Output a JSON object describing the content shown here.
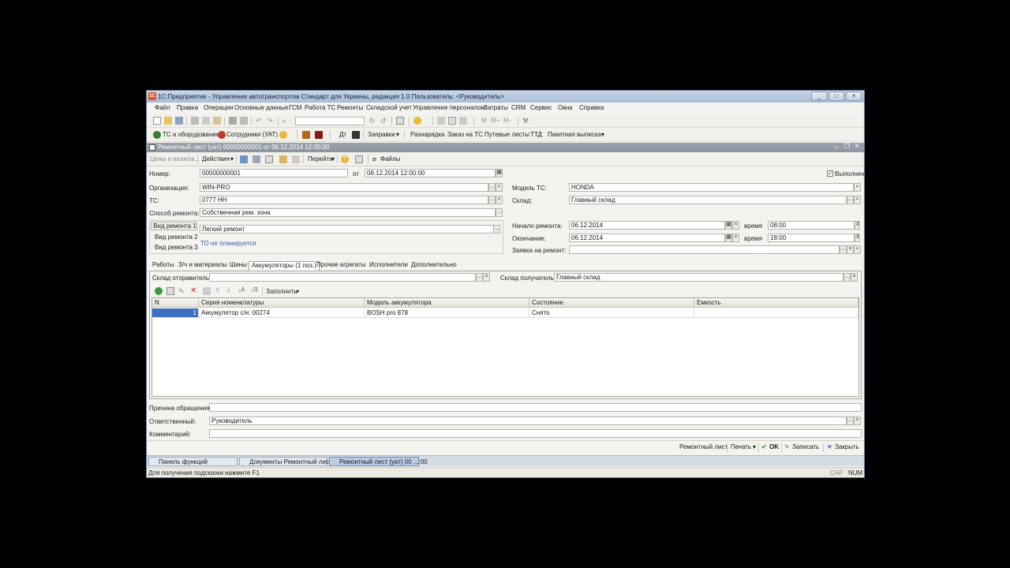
{
  "window": {
    "title": "1С:Предприятие - Управление автотранспортом Стандарт для Украины, редакция 1.0    Пользователь: <Руководитель>",
    "minimize": "_",
    "maximize": "□",
    "close": "×"
  },
  "menu": [
    "Файл",
    "Правка",
    "Операции",
    "Основные данные",
    "ГСМ",
    "Работа ТС",
    "Ремонты",
    "Складской учет",
    "Управление персоналом",
    "Затраты",
    "CRM",
    "Сервис",
    "Окна",
    "Справка"
  ],
  "toolbar2": {
    "ts": "ТС и оборудование",
    "staff": "Сотрудники (УАТ)",
    "dt": "Дт",
    "fuel": "Заправки",
    "raznaryadka": "Разнарядка",
    "order": "Заказ на ТС",
    "waybills": "Путевые листы",
    "ttd": "ТТД",
    "batch": "Пакетная выписка"
  },
  "document": {
    "title": "Ремонтный лист (уат) 00000000001 от 06.12.2014 12:00:00",
    "actions": {
      "prices": "Цены и валюта...",
      "actions": "Действия",
      "goto": "Перейти",
      "files": "Файлы"
    },
    "number_label": "Номер:",
    "number": "00000000001",
    "from_label": "от",
    "date": "06.12.2014 12:00:00",
    "done_label": "Выполнен",
    "org_label": "Организация:",
    "org": "WIN-PRO",
    "ts_label": "ТС:",
    "ts": "0777 НН",
    "method_label": "Способ ремонта:",
    "method": "Собственная рем. зона",
    "repair_type1_btn": "Вид ремонта 1",
    "repair_type2_btn": "Вид ремонта 2",
    "repair_type3_btn": "Вид ремонта 3",
    "repair_type1": "Легкий ремонт",
    "to_link": "ТО не планируется",
    "model_label": "Модель ТС:",
    "model": "HONDA",
    "warehouse_label": "Склад:",
    "warehouse": "Главный склад",
    "start_label": "Начало ремонта:",
    "start_date": "06.12.2014",
    "time_label": "время",
    "start_time": "08:00",
    "end_label": "Окончание:",
    "end_date": "06.12.2014",
    "end_time": "18:00",
    "request_label": "Заявка на ремонт:",
    "request": ""
  },
  "tabs": [
    "Работы",
    "З/ч и материалы",
    "Шины",
    "Аккумуляторы (1 поз.)",
    "Прочие агрегаты",
    "Исполнители",
    "Дополнительно"
  ],
  "tab_panel": {
    "sender_label": "Склад отправитель:",
    "sender": "",
    "receiver_label": "Склад получатель:",
    "receiver": "Главный склад",
    "fill": "Заполнить"
  },
  "grid": {
    "headers": [
      "N",
      "Серия номенклатуры",
      "Модель аккумулятора",
      "Состояние",
      "Емкость"
    ],
    "rows": [
      [
        "1",
        "Аккумулятор с/н: 00274",
        "BOSH pro 878",
        "Снято",
        ""
      ]
    ]
  },
  "bottom": {
    "reason_label": "Причина обращения:",
    "reason": "",
    "responsible_label": "Ответственный:",
    "responsible": "Руководитель",
    "comment_label": "Комментарий:",
    "comment": "",
    "repair_sheet": "Ремонтный лист",
    "print": "Печать",
    "ok": "OK",
    "save": "Записать",
    "close": "Закрыть"
  },
  "taskbar": [
    "Панель функций",
    "Документы Ремонтный лист",
    "Ремонтный лист (уат) 00 ...:00"
  ],
  "status": {
    "hint": "Для получения подсказки нажмите F1",
    "cap": "CAP",
    "num": "NUM"
  }
}
